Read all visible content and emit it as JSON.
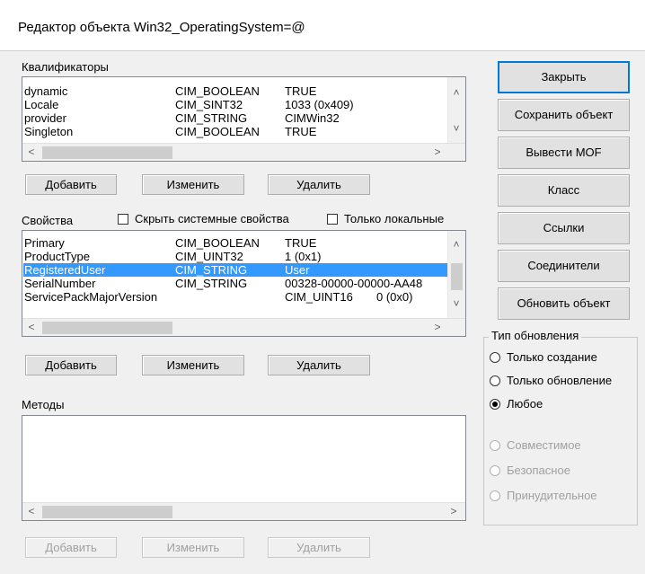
{
  "window": {
    "title": "Редактор объекта Win32_OperatingSystem=@"
  },
  "qualifiers": {
    "label": "Квалификаторы",
    "rows": [
      {
        "name": "dynamic",
        "type": "CIM_BOOLEAN",
        "value": "TRUE"
      },
      {
        "name": "Locale",
        "type": "CIM_SINT32",
        "value": "1033 (0x409)"
      },
      {
        "name": "provider",
        "type": "CIM_STRING",
        "value": "CIMWin32"
      },
      {
        "name": "Singleton",
        "type": "CIM_BOOLEAN",
        "value": "TRUE"
      }
    ],
    "add_label": "Добавить",
    "edit_label": "Изменить",
    "delete_label": "Удалить"
  },
  "properties": {
    "label": "Свойства",
    "hide_system_label": "Скрыть системные свойства",
    "hide_system_checked": false,
    "local_only_label": "Только локальные",
    "local_only_checked": false,
    "rows": [
      {
        "name": "Primary",
        "type": "CIM_BOOLEAN",
        "value": "TRUE",
        "selected": false
      },
      {
        "name": "ProductType",
        "type": "CIM_UINT32",
        "value": "1 (0x1)",
        "selected": false
      },
      {
        "name": "RegisteredUser",
        "type": "CIM_STRING",
        "value": "User",
        "selected": true
      },
      {
        "name": "SerialNumber",
        "type": "CIM_STRING",
        "value": "00328-00000-00000-AA48",
        "selected": false
      },
      {
        "name": "ServicePackMajorVersion",
        "type": "CIM_UINT16",
        "value": "0 (0x0)",
        "selected": false
      }
    ],
    "add_label": "Добавить",
    "edit_label": "Изменить",
    "delete_label": "Удалить"
  },
  "methods": {
    "label": "Методы",
    "add_label": "Добавить",
    "edit_label": "Изменить",
    "delete_label": "Удалить"
  },
  "side_buttons": {
    "close": "Закрыть",
    "save_object": "Сохранить объект",
    "show_mof": "Вывести MOF",
    "class": "Класс",
    "references": "Ссылки",
    "associators": "Соединители",
    "refresh_object": "Обновить объект"
  },
  "update_type": {
    "label": "Тип обновления",
    "options": [
      {
        "label": "Только создание",
        "selected": false,
        "enabled": true
      },
      {
        "label": "Только обновление",
        "selected": false,
        "enabled": true
      },
      {
        "label": "Любое",
        "selected": true,
        "enabled": true
      },
      {
        "label": "Совместимое",
        "selected": false,
        "enabled": false
      },
      {
        "label": "Безопасное",
        "selected": false,
        "enabled": false
      },
      {
        "label": "Принудительное",
        "selected": false,
        "enabled": false
      }
    ]
  },
  "colors": {
    "selection": "#3399ff",
    "default_border": "#0078d7"
  }
}
